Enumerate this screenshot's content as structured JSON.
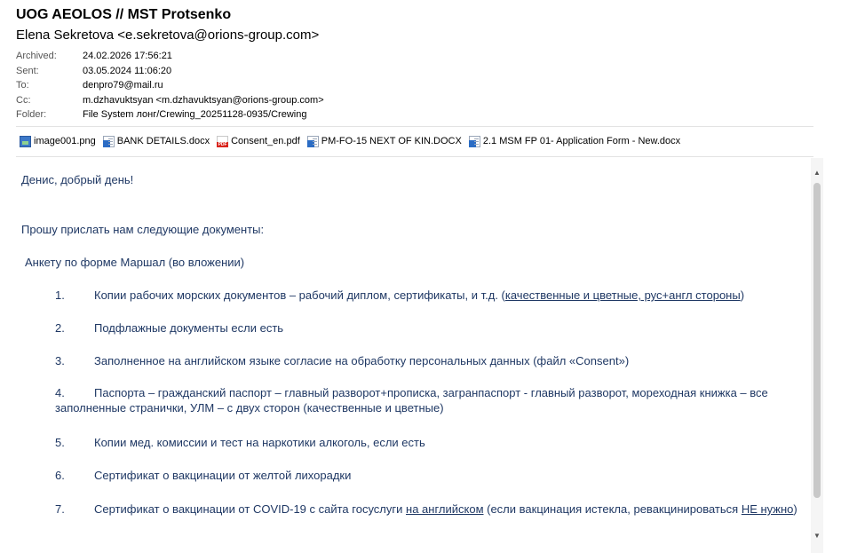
{
  "email": {
    "subject": "UOG AEOLOS // MST Protsenko",
    "sender": "Elena Sekretova <e.sekretova@orions-group.com>",
    "meta": [
      {
        "key": "Archived:",
        "value": "24.02.2026 17:56:21"
      },
      {
        "key": "Sent:",
        "value": "03.05.2024 11:06:20"
      },
      {
        "key": "To:",
        "value": "denpro79@mail.ru"
      },
      {
        "key": "Cc:",
        "value": "m.dzhavuktsyan <m.dzhavuktsyan@orions-group.com>"
      },
      {
        "key": "Folder:",
        "value": "File System лонг/Crewing_20251128-0935/Crewing"
      }
    ],
    "attachments": [
      {
        "name": "image001.png",
        "icon": "image-file-icon"
      },
      {
        "name": "BANK DETAILS.docx",
        "icon": "word-document-icon"
      },
      {
        "name": "Consent_en.pdf",
        "icon": "pdf-file-icon"
      },
      {
        "name": "PM-FO-15 NEXT OF KIN.DOCX",
        "icon": "word-document-icon"
      },
      {
        "name": "2.1 MSM FP 01- Application Form - New.docx",
        "icon": "word-document-icon"
      }
    ]
  },
  "body": {
    "greeting": "Денис, добрый день!",
    "request": "Прошу прислать нам следующие документы:",
    "form_line": "Анкету по форме Маршал (во вложении)",
    "items": [
      {
        "num": "1.",
        "text": "Копии рабочих морских документов – рабочий диплом, сертификаты, и т.д. (",
        "ul": "качественные и цветные, рус+англ стороны",
        "tail": ")"
      },
      {
        "num": "2.",
        "text": "Подфлажные документы если есть"
      },
      {
        "num": "3.",
        "text": "Заполненное на английском языке согласие на обработку персональных данных (файл «Consent»)"
      },
      {
        "num": "4.",
        "text": "Паспорта – гражданский паспорт – главный разворот+прописка, загранпаспорт - главный разворот, мореходная книжка – все заполненные странички, УЛМ – с двух сторон (качественные и цветные)"
      },
      {
        "num": "5.",
        "text": "Копии мед. комиссии и тест на наркотики алкоголь, если есть"
      },
      {
        "num": "6.",
        "text": "Сертификат о вакцинации от желтой лихорадки"
      },
      {
        "num": "7.",
        "text": "Сертификат о вакцинации от COVID-19 с сайта госуслуги ",
        "ul": "на английском",
        "tail": " (если вакцинация истекла, ревакцинироваться ",
        "ul2": "НЕ нужно",
        "tail2": ")"
      }
    ]
  }
}
